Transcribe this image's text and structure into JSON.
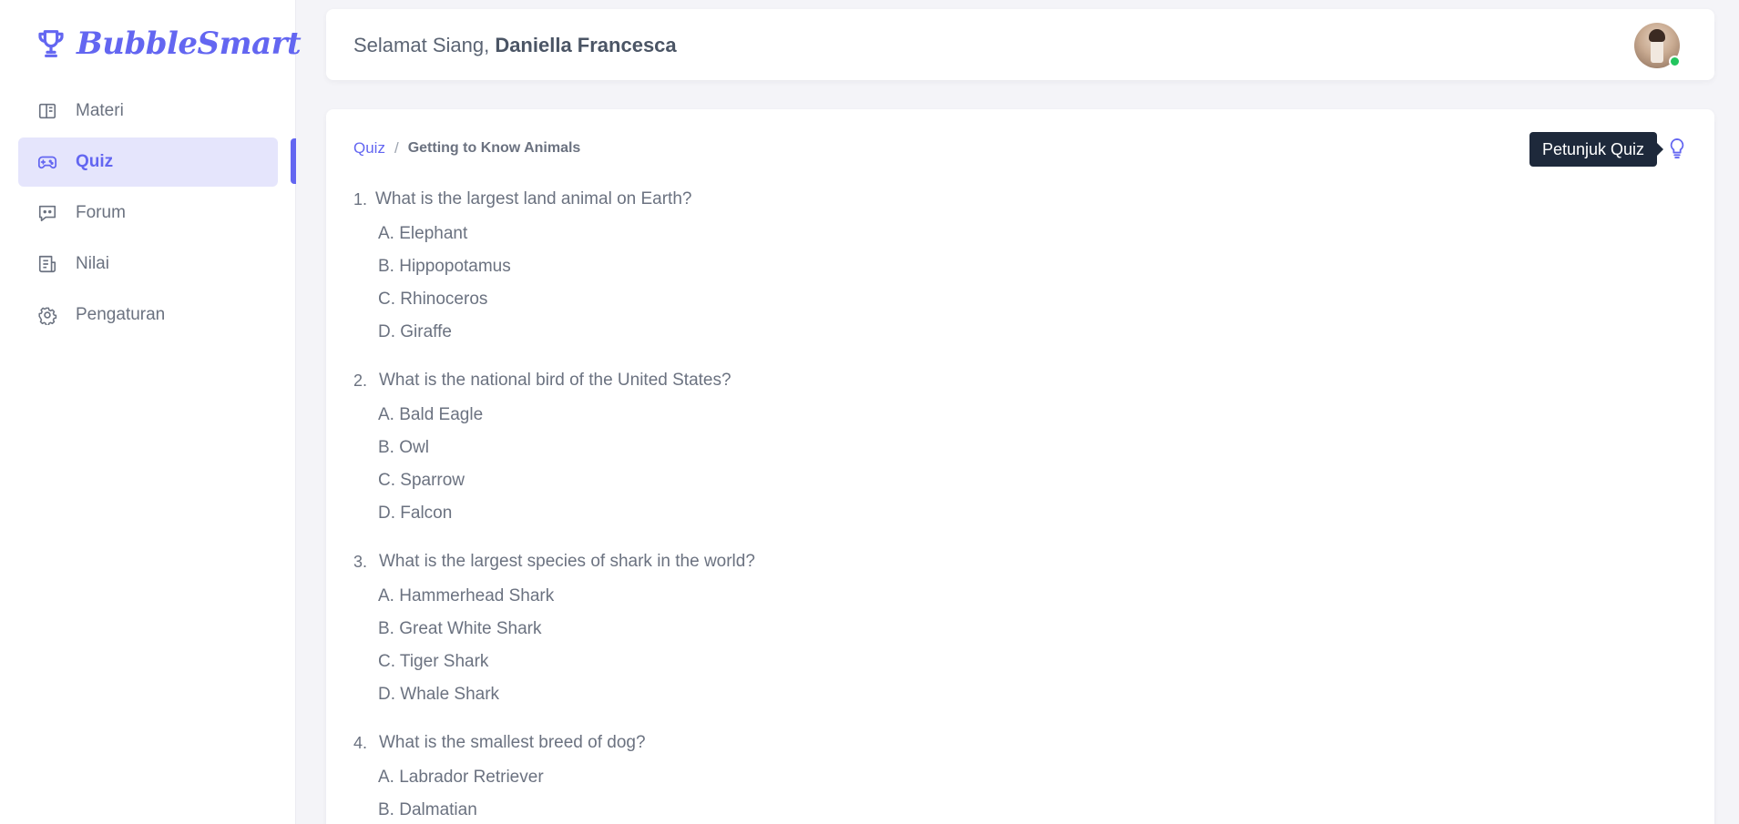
{
  "brand": {
    "name": "BubbleSmart",
    "color": "#6366f1"
  },
  "sidebar": {
    "items": [
      {
        "label": "Materi",
        "icon": "book-icon",
        "active": false
      },
      {
        "label": "Quiz",
        "icon": "gamepad-icon",
        "active": true
      },
      {
        "label": "Forum",
        "icon": "chat-icon",
        "active": false
      },
      {
        "label": "Nilai",
        "icon": "report-icon",
        "active": false
      },
      {
        "label": "Pengaturan",
        "icon": "gear-icon",
        "active": false
      }
    ]
  },
  "header": {
    "greeting": "Selamat Siang, ",
    "user_name": "Daniella Francesca",
    "status": "online"
  },
  "breadcrumb": {
    "root": "Quiz",
    "separator": "/",
    "current": "Getting to Know Animals"
  },
  "hint": {
    "tooltip": "Petunjuk Quiz",
    "icon": "lightbulb-icon"
  },
  "questions": [
    {
      "number": "1.",
      "text": "What is the largest land animal on Earth?",
      "options": [
        "A. Elephant",
        "B. Hippopotamus",
        "C. Rhinoceros",
        "D. Giraffe"
      ]
    },
    {
      "number": "2.",
      "text": "What is the national bird of the United States?",
      "options": [
        "A. Bald Eagle",
        "B. Owl",
        "C. Sparrow",
        "D. Falcon"
      ]
    },
    {
      "number": "3.",
      "text": "What is the largest species of shark in the world?",
      "options": [
        "A. Hammerhead Shark",
        "B. Great White Shark",
        "C. Tiger Shark",
        "D. Whale Shark"
      ]
    },
    {
      "number": "4.",
      "text": "What is the smallest breed of dog?",
      "options": [
        "A. Labrador Retriever",
        "B. Dalmatian"
      ]
    }
  ]
}
